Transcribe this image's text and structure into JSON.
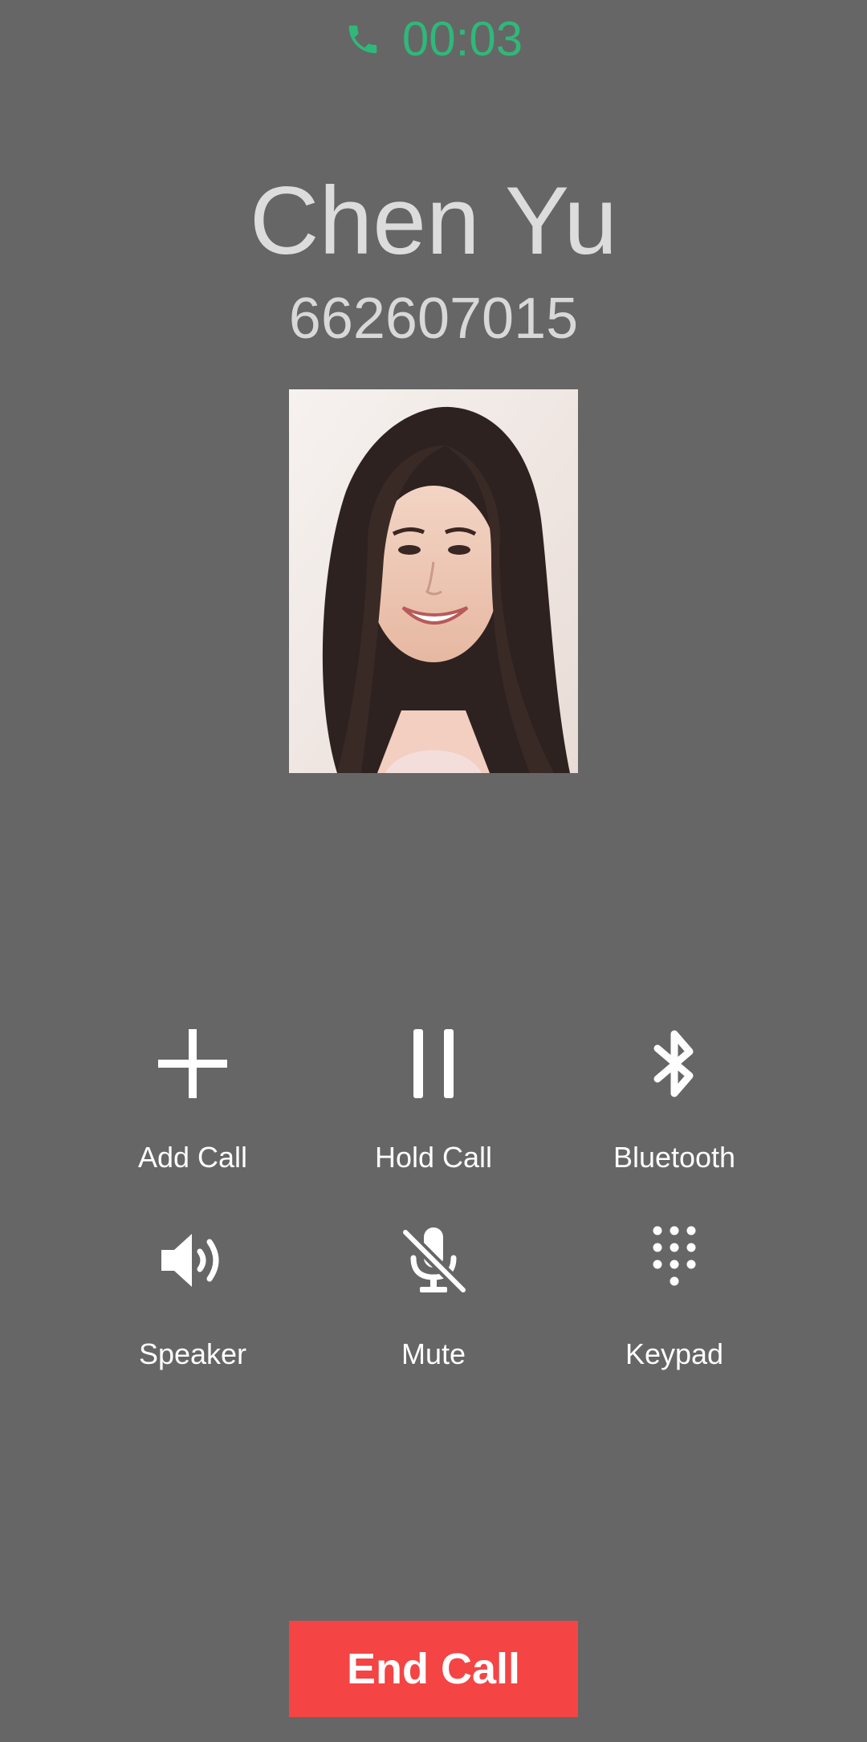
{
  "call": {
    "timer": "00:03",
    "timer_color": "#2fb87a",
    "status_icon": "phone-icon"
  },
  "caller": {
    "name": "Chen Yu",
    "number": "662607015",
    "photo": "contact-photo"
  },
  "controls": [
    {
      "label": "Add Call",
      "icon": "plus-icon"
    },
    {
      "label": "Hold Call",
      "icon": "pause-icon"
    },
    {
      "label": "Bluetooth",
      "icon": "bluetooth-icon"
    },
    {
      "label": "Speaker",
      "icon": "speaker-icon"
    },
    {
      "label": "Mute",
      "icon": "mic-off-icon"
    },
    {
      "label": "Keypad",
      "icon": "keypad-icon"
    }
  ],
  "end_call": {
    "label": "End Call",
    "color": "#f44444"
  },
  "background_color": "#666666"
}
